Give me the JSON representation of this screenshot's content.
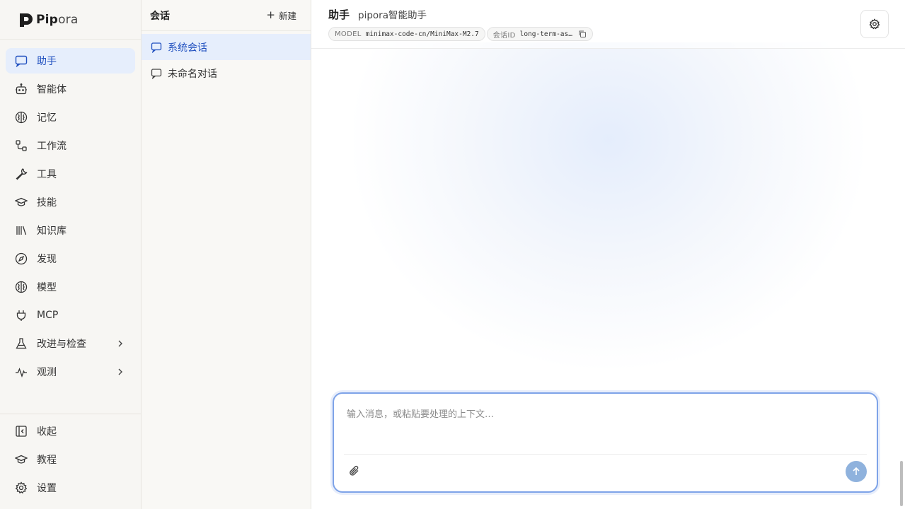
{
  "brand": {
    "name_strong": "Pip",
    "name_light": "ora"
  },
  "nav": {
    "items": [
      {
        "label": "助手",
        "icon": "chat-icon"
      },
      {
        "label": "智能体",
        "icon": "robot-icon"
      },
      {
        "label": "记忆",
        "icon": "brain-icon"
      },
      {
        "label": "工作流",
        "icon": "workflow-icon"
      },
      {
        "label": "工具",
        "icon": "wrench-icon"
      },
      {
        "label": "技能",
        "icon": "graduation-cap-icon"
      },
      {
        "label": "知识库",
        "icon": "library-icon"
      },
      {
        "label": "发现",
        "icon": "compass-icon"
      },
      {
        "label": "模型",
        "icon": "brain-icon"
      },
      {
        "label": "MCP",
        "icon": "plug-icon"
      },
      {
        "label": "改进与检查",
        "icon": "flask-icon"
      },
      {
        "label": "观测",
        "icon": "activity-icon"
      }
    ],
    "bottom": [
      {
        "label": "收起",
        "icon": "collapse-icon"
      },
      {
        "label": "教程",
        "icon": "graduation-cap-icon"
      },
      {
        "label": "设置",
        "icon": "gear-icon"
      }
    ]
  },
  "conversations": {
    "title": "会话",
    "new_label": "新建",
    "items": [
      {
        "label": "系统会话"
      },
      {
        "label": "未命名对话"
      }
    ]
  },
  "header": {
    "title": "助手",
    "subtitle": "pipora智能助手",
    "model_key": "MODEL",
    "model_value": "minimax-code-cn/MiniMax-M2.7",
    "session_key": "会话ID",
    "session_value": "long-term-as…"
  },
  "composer": {
    "placeholder": "输入消息，或粘贴要处理的上下文…"
  },
  "colors": {
    "accent": "#1f4fbf",
    "active_bg": "#e6eefc",
    "focus_border": "#7ea3e8",
    "send_button": "#8fb2dd"
  }
}
